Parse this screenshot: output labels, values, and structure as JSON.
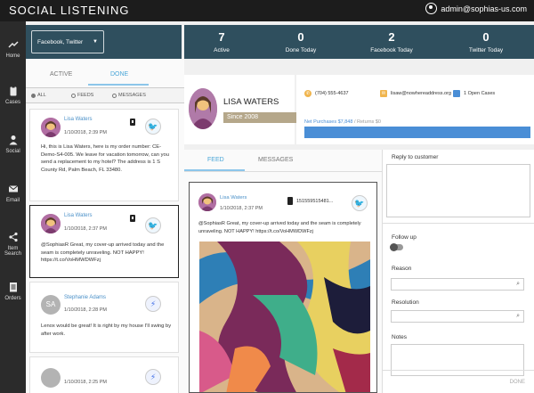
{
  "app": {
    "title": "SOCIAL LISTENING",
    "user_email": "admin@sophias-us.com"
  },
  "nav": [
    {
      "label": "Home",
      "icon": "trend-icon"
    },
    {
      "label": "Cases",
      "icon": "clipboard-icon"
    },
    {
      "label": "Social",
      "icon": "person-icon"
    },
    {
      "label": "Email",
      "icon": "envelope-icon"
    },
    {
      "label": "Item Search",
      "icon": "share-icon"
    },
    {
      "label": "Orders",
      "icon": "document-icon"
    }
  ],
  "filter": {
    "selected": "Facebook, Twitter"
  },
  "stats": [
    {
      "value": "7",
      "label": "Active"
    },
    {
      "value": "0",
      "label": "Done Today"
    },
    {
      "value": "2",
      "label": "Facebook Today"
    },
    {
      "value": "0",
      "label": "Twitter Today"
    }
  ],
  "list": {
    "tabs": [
      "ACTIVE",
      "DONE"
    ],
    "active_tab": "DONE",
    "filters": [
      "ALL",
      "FEEDS",
      "MESSAGES"
    ],
    "selected_filter": "ALL",
    "items": [
      {
        "name": "Lisa Waters",
        "date": "1/10/2018, 2:39 PM",
        "network": "twitter",
        "message": "Hi, this is Lisa Waters, here is my order number: CE-Demo-S4-005. We leave for vacation tomorrow, can you send a replacement to my hotel? The address is 1 S County Rd, Palm Beach, FL 33480."
      },
      {
        "name": "Lisa Waters",
        "date": "1/10/2018, 2:37 PM",
        "network": "twitter",
        "message": "@SophiasR Great, my cover-up arrived today and the seam is completely unraveling. NOT HAPPY! https://t.co/VoHMWDWFzj"
      },
      {
        "name": "Stephanie Adams",
        "initials": "SA",
        "date": "1/10/2018, 2:28 PM",
        "network": "messenger",
        "message": "Lenox would be great! It is right by my house I'll swing by after work."
      },
      {
        "name": "",
        "date": "1/10/2018, 2:25 PM",
        "network": "messenger",
        "message": ""
      }
    ]
  },
  "contact": {
    "name": "LISA WATERS",
    "since": "Since 2008",
    "phone": "(704) 555-4637",
    "email": "lisaw@nowhereaddress.org",
    "open_cases": "1 Open Cases",
    "net_purchases_label": "Net Purchases $7,848",
    "returns_label": "/ Returns $0",
    "purchase_fraction": 1.0
  },
  "feed": {
    "tabs": [
      "FEED",
      "MESSAGES"
    ],
    "active_tab": "FEED",
    "post": {
      "name": "Lisa Waters",
      "date": "1/10/2018, 2:37 PM",
      "post_id": "151559515481...",
      "message": "@SophiasR Great, my cover-up arrived today and the seam is completely unraveling. NOT HAPPY! https://t.co/VoHMWDWFzj"
    }
  },
  "reply": {
    "reply_label": "Reply to customer",
    "followup_label": "Follow up",
    "reason_label": "Reason",
    "resolution_label": "Resolution",
    "notes_label": "Notes",
    "done_label": "DONE"
  },
  "colors": {
    "header": "#2f4f5e",
    "accent": "#4a8ed6",
    "tab_active": "#4aa6d8",
    "twitter": "#2a9de0",
    "since_badge": "#b5a78a"
  }
}
